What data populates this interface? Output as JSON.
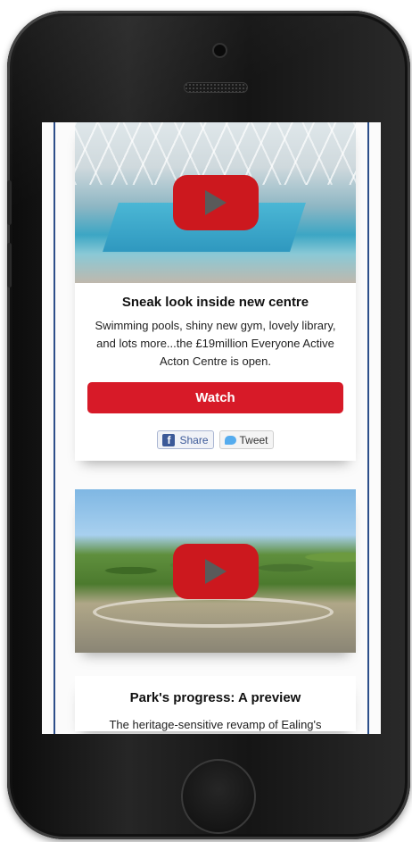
{
  "stories": [
    {
      "image_alt": "",
      "title": "Sneak look inside new centre",
      "description": "Swimming pools, shiny new gym, lovely library, and lots more...the £19million Everyone Active Acton Centre is open.",
      "watch_label": "Watch",
      "share_label": "Share",
      "tweet_label": "Tweet"
    },
    {
      "title": "Park's progress: A preview",
      "description_partial": "The heritage-sensitive revamp of Ealing's"
    }
  ],
  "colors": {
    "watch_button": "#d71a28",
    "play_button": "#cc181e",
    "frame_line": "#2d4f8a",
    "facebook": "#3b5998",
    "twitter": "#55acee"
  },
  "icons": {
    "play": "play-icon",
    "facebook": "facebook-icon",
    "twitter": "twitter-bird-icon"
  }
}
